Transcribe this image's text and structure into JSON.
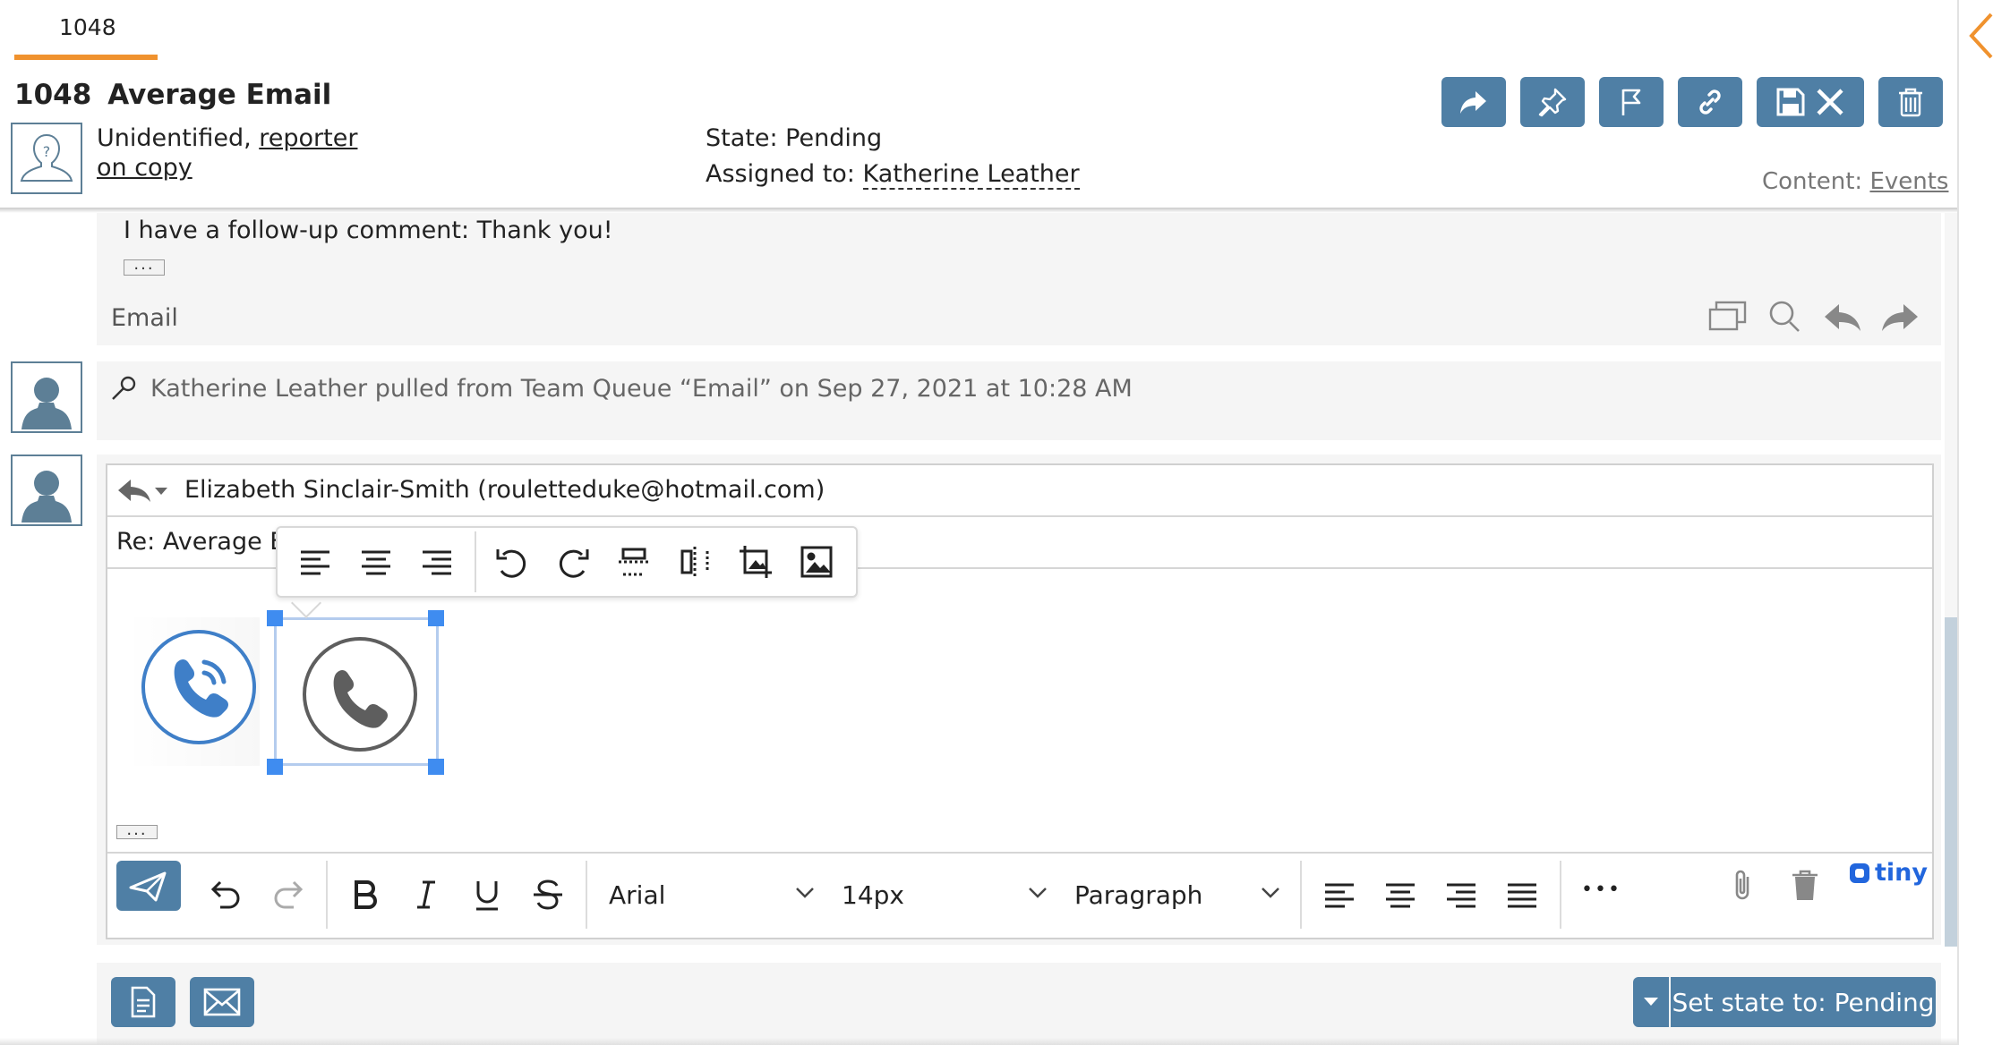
{
  "tab": {
    "label": "1048"
  },
  "ticket": {
    "number": "1048",
    "title": "Average Email"
  },
  "reporter": {
    "prefix": "Unidentified,",
    "link_part1": "reporter",
    "link_part2": "on copy"
  },
  "state": {
    "label": "State:",
    "value": "Pending"
  },
  "assigned": {
    "label": "Assigned to:",
    "value": "Katherine Leather"
  },
  "content": {
    "label": "Content:",
    "link": "Events"
  },
  "toolbar_icons": [
    "forward-icon",
    "pin-icon",
    "flag-icon",
    "link-icon",
    "save-icon",
    "close-icon",
    "trash-icon"
  ],
  "message": {
    "text": "I have a follow-up comment: Thank you!",
    "dots": "...",
    "channel": "Email"
  },
  "event": {
    "text": "Katherine Leather pulled from Team Queue “Email” on Sep 27, 2021 at 10:28 AM"
  },
  "reply": {
    "to": "Elizabeth Sinclair-Smith (rouletteduke@hotmail.com)",
    "subject": "Re: Average Email",
    "dots": "..."
  },
  "editor": {
    "font": "Arial",
    "size": "14px",
    "block": "Paragraph",
    "more": "•••",
    "brand": "tiny"
  },
  "footer": {
    "state_button": "Set state to: Pending"
  },
  "colors": {
    "accent": "#f0922e",
    "button": "#4f7fa5",
    "selection": "#3f8cf0",
    "brand": "#2266dd"
  }
}
